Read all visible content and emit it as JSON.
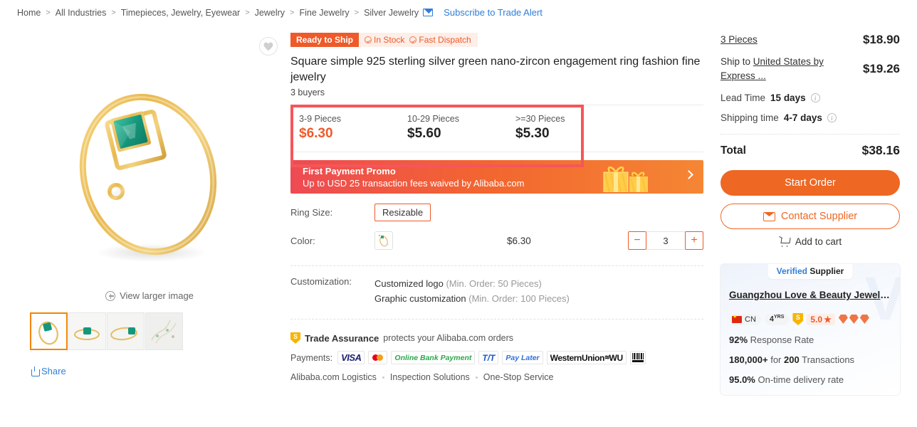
{
  "breadcrumb": {
    "items": [
      "Home",
      "All Industries",
      "Timepieces, Jewelry, Eyewear",
      "Jewelry",
      "Fine Jewelry",
      "Silver Jewelry"
    ],
    "separator": ">",
    "trade_alert": "Subscribe to Trade Alert"
  },
  "gallery": {
    "view_larger": "View larger image",
    "share": "Share",
    "wishlist_icon": "heart-icon",
    "thumbnail_count": 4,
    "active_thumbnail_index": 0
  },
  "product": {
    "ready_to_ship": "Ready to Ship",
    "in_stock": "In Stock",
    "fast_dispatch": "Fast Dispatch",
    "title": "Square simple 925 sterling silver green nano-zircon engagement ring fashion fine jewelry",
    "buyers": "3 buyers"
  },
  "price_tiers": [
    {
      "qty": "3-9 Pieces",
      "price": "$6.30",
      "highlighted": true
    },
    {
      "qty": "10-29 Pieces",
      "price": "$5.60",
      "highlighted": false
    },
    {
      "qty": ">=30 Pieces",
      "price": "$5.30",
      "highlighted": false
    }
  ],
  "highlight_box_color": "#f5565a",
  "promo": {
    "title": "First Payment Promo",
    "subtitle": "Up to USD 25 transaction fees waived by Alibaba.com",
    "arrow_icon": "chevron-right-icon",
    "gift_icon": "gift-box-icon"
  },
  "attributes": {
    "ring_size_label": "Ring Size:",
    "ring_size_value": "Resizable",
    "color_label": "Color:",
    "color_price": "$6.30",
    "quantity": "3",
    "minus_label": "−",
    "plus_label": "+"
  },
  "customization": {
    "label": "Customization:",
    "options": [
      {
        "name": "Customized logo",
        "min": "(Min. Order: 50 Pieces)"
      },
      {
        "name": "Graphic customization",
        "min": "(Min. Order: 100 Pieces)"
      }
    ]
  },
  "assurance": {
    "title": "Trade Assurance",
    "text": "protects your Alibaba.com orders",
    "shield_letter": "S"
  },
  "payments": {
    "label": "Payments:",
    "methods": [
      "VISA",
      "Mastercard",
      "Online Bank Payment",
      "T/T",
      "Pay Later",
      "WesternUnion WU",
      "Boleto"
    ],
    "visa": "VISA",
    "online_bank": "Online Bank Payment",
    "tt": "T/T",
    "pay_later": "Pay Later",
    "western_union": "WesternUnion",
    "wu_short": "WU"
  },
  "service_links": [
    "Alibaba.com Logistics",
    "Inspection Solutions",
    "One-Stop Service"
  ],
  "order_summary": {
    "pieces_label": "3 Pieces",
    "pieces_price": "$18.90",
    "ship_to_prefix": "Ship to ",
    "ship_to_link": "United States by Express ...",
    "ship_price": "$19.26",
    "lead_time_label": "Lead Time",
    "lead_time_value": "15 days",
    "shipping_time_label": "Shipping time",
    "shipping_time_value": "4-7 days",
    "total_label": "Total",
    "total_value": "$38.16",
    "info_icon": "info-icon"
  },
  "actions": {
    "start_order": "Start Order",
    "contact_supplier": "Contact Supplier",
    "add_to_cart": "Add to cart",
    "envelope_icon": "envelope-icon",
    "cart_icon": "shopping-cart-icon"
  },
  "supplier": {
    "verified_v": "V",
    "verified_rest": "erified",
    "verified_supplier": "Supplier",
    "name": "Guangzhou Love & Beauty Jewelr...",
    "country_code": "CN",
    "years": "4",
    "years_sup": "YRS",
    "rating": "5.0",
    "star": "★",
    "gem_count": 3,
    "response_rate_value": "92%",
    "response_rate_label": "Response Rate",
    "transactions_value": "180,000+",
    "transactions_mid": "for",
    "transactions_count": "200",
    "transactions_label": "Transactions",
    "ontime_value": "95.0%",
    "ontime_label": "On-time delivery rate"
  },
  "colors": {
    "accent_orange": "#ee6723",
    "ready_ship_bg": "#ee5a29",
    "link_blue": "#2f7ed8",
    "highlight_red": "#f5565a"
  }
}
